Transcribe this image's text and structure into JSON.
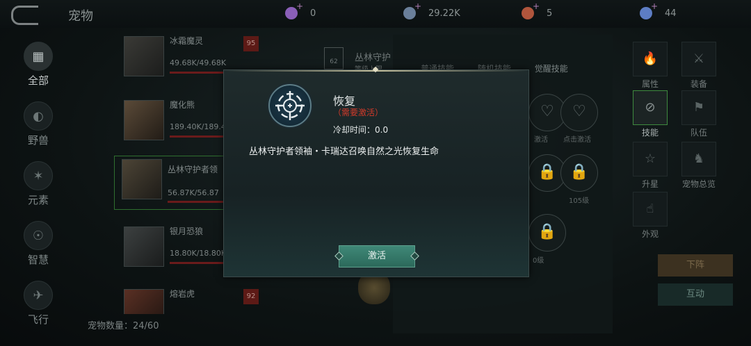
{
  "header": {
    "title": "宠物"
  },
  "resources": [
    {
      "value": "0",
      "color": "#8a5fb8"
    },
    {
      "value": "29.22K",
      "color": "#6a7f9a"
    },
    {
      "value": "5",
      "color": "#b0553c"
    },
    {
      "value": "44",
      "color": "#5d7dc4"
    }
  ],
  "left_nav": [
    {
      "label": "全部",
      "icon": "grid-icon"
    },
    {
      "label": "野兽",
      "icon": "beast-icon"
    },
    {
      "label": "元素",
      "icon": "element-icon"
    },
    {
      "label": "智慧",
      "icon": "wisdom-icon"
    },
    {
      "label": "飞行",
      "icon": "flying-icon"
    }
  ],
  "pets": [
    {
      "name": "冰霜魔灵",
      "hp": "49.68K/49.68K",
      "level": "95",
      "hp_fraction": 1.0
    },
    {
      "name": "魔化熊",
      "hp": "189.40K/189.4",
      "level": "",
      "hp_fraction": 1.0
    },
    {
      "name": "丛林守护者领",
      "hp": "56.87K/56.87",
      "level": "",
      "hp_fraction": 1.0
    },
    {
      "name": "银月恐狼",
      "hp": "18.80K/18.80K",
      "level": "",
      "hp_fraction": 1.0
    },
    {
      "name": "熔岩虎",
      "hp": "",
      "level": "92",
      "hp_fraction": 1.0
    }
  ],
  "pet_count": "宠物数量：24/60",
  "background_panel": {
    "title": "丛林守护",
    "subtitle": "等级上限",
    "shield_level": "62",
    "tabs": [
      "普通技能",
      "随机技能",
      "觉醒技能"
    ],
    "skill_labels": [
      "激活",
      "点击激活",
      "105级",
      "0级"
    ]
  },
  "right_nav": [
    {
      "label": "属性",
      "icon": "flame-icon"
    },
    {
      "label": "装备",
      "icon": "swords-icon"
    },
    {
      "label": "技能",
      "icon": "skill-icon"
    },
    {
      "label": "队伍",
      "icon": "flag-icon"
    },
    {
      "label": "升星",
      "icon": "star-icon"
    },
    {
      "label": "宠物总览",
      "icon": "overview-icon"
    },
    {
      "label": "外观",
      "icon": "hand-icon"
    }
  ],
  "action_buttons": {
    "down": "下阵",
    "interact": "互动"
  },
  "modal": {
    "skill_name": "恢复",
    "requirement": "（需要激活）",
    "cooldown": "冷却时间：0.0",
    "description": "丛林守护者领袖・卡瑞达召唤自然之光恢复生命",
    "activate_label": "激活"
  }
}
